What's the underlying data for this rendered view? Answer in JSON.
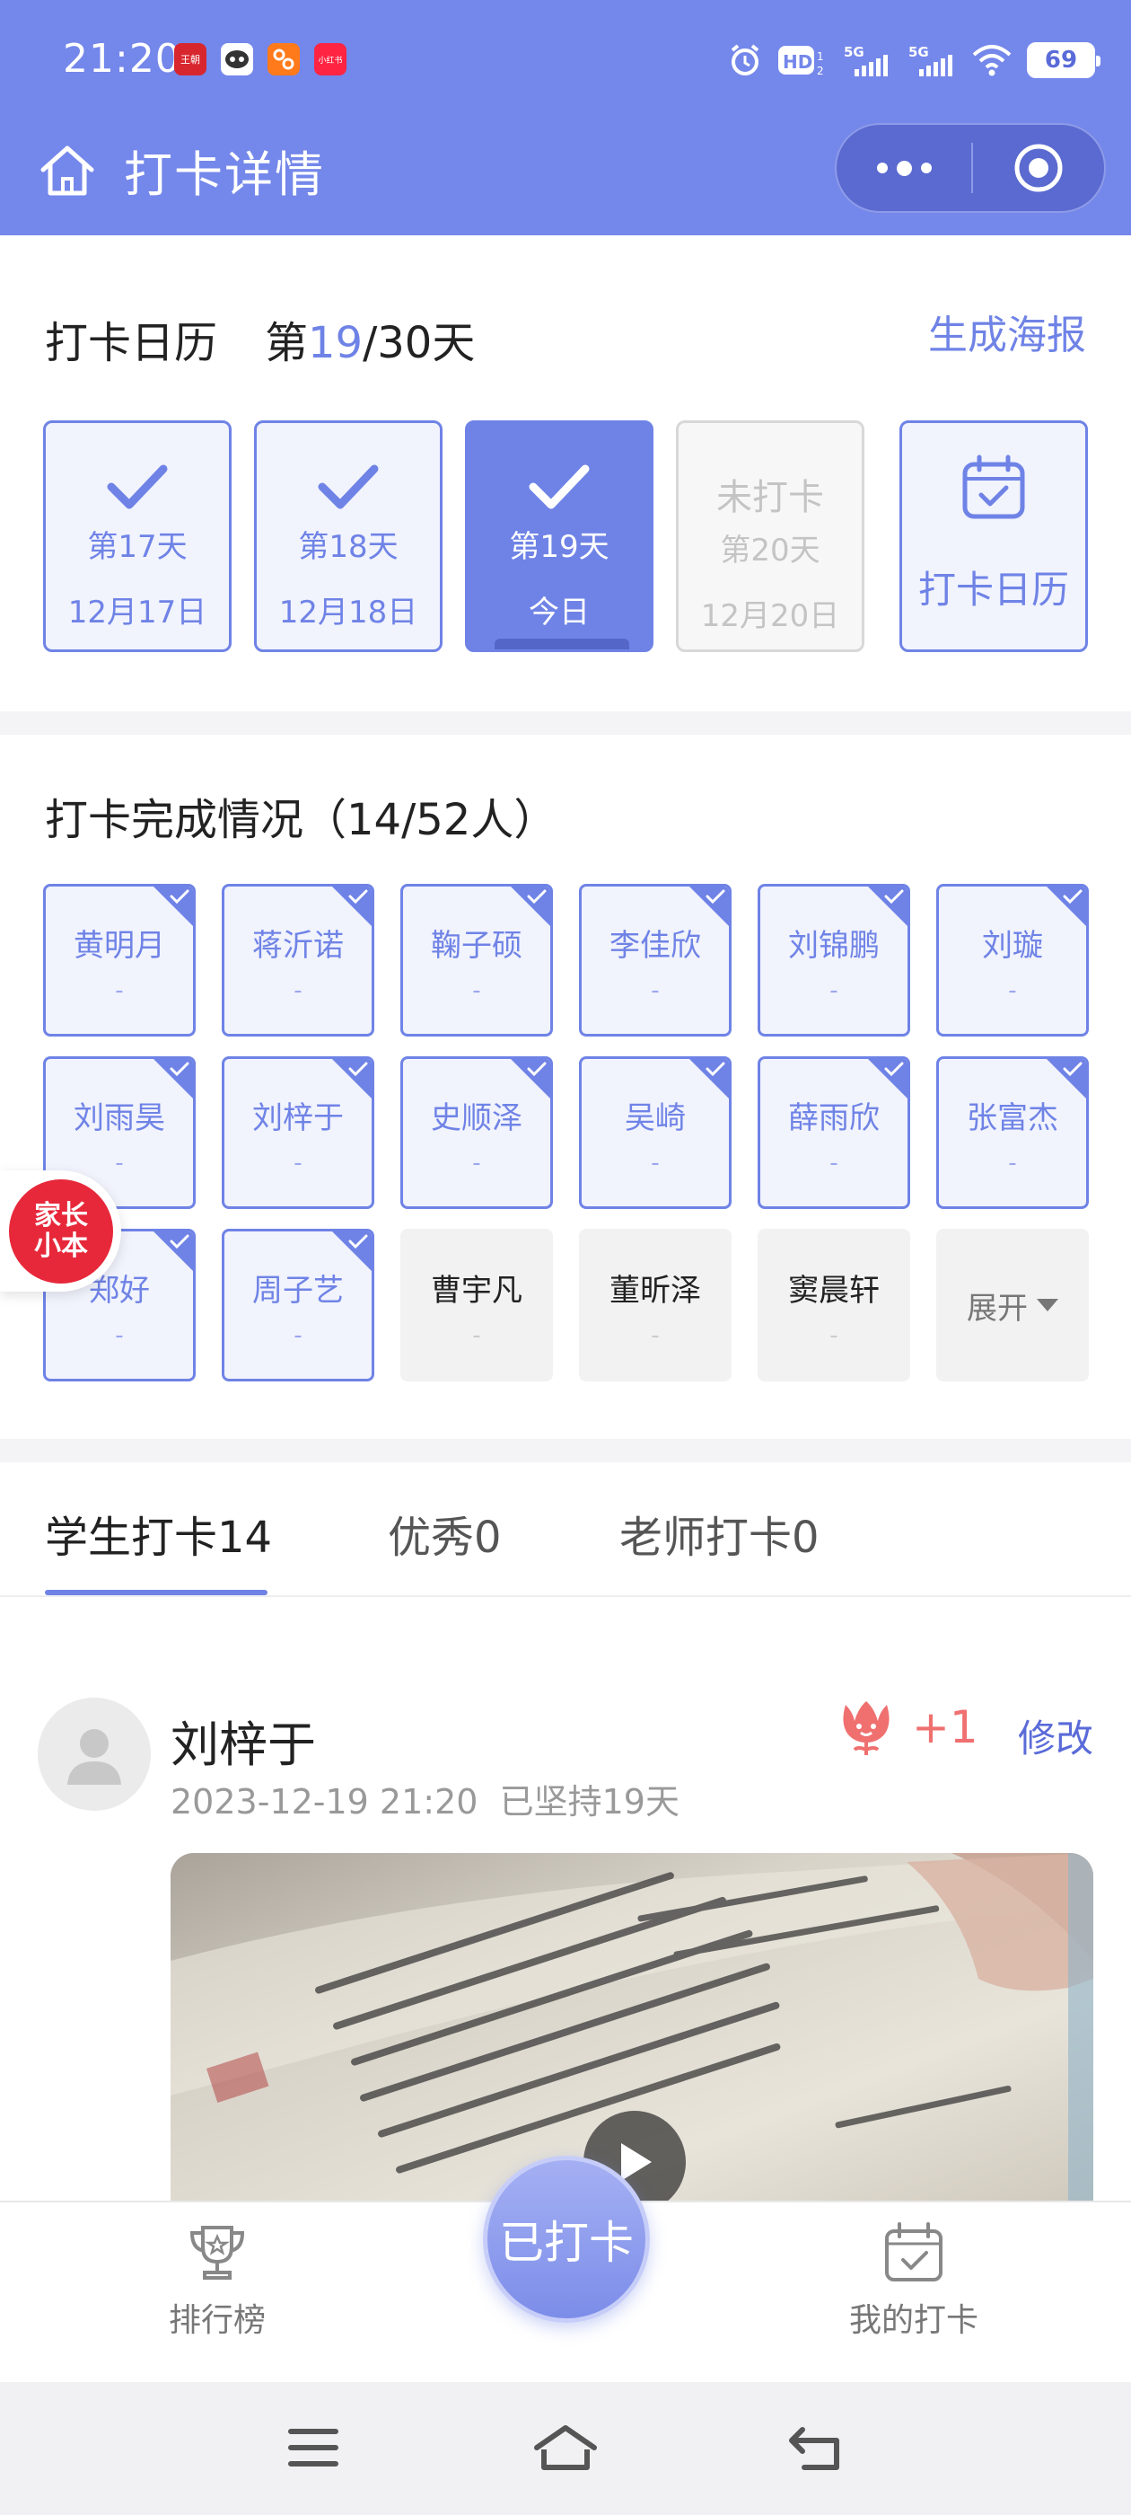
{
  "status_bar": {
    "time": "21:20",
    "app_icons": [
      {
        "name": "app-icon-1",
        "label": "王朝",
        "color": "#d8262e"
      },
      {
        "name": "app-icon-2",
        "label": "",
        "color": "#ffffff"
      },
      {
        "name": "app-icon-3",
        "label": "",
        "color": "#ff7a1a"
      },
      {
        "name": "app-icon-4",
        "label": "小红书",
        "color": "#ff2442"
      }
    ],
    "battery": "69"
  },
  "nav": {
    "title": "打卡详情"
  },
  "calendar": {
    "title": "打卡日历",
    "day_prefix": "第",
    "day_current": "19",
    "day_suffix": "/30天",
    "poster_label": "生成海报",
    "days": [
      {
        "day": "第17天",
        "date": "12月17日",
        "state": "done"
      },
      {
        "day": "第18天",
        "date": "12月18日",
        "state": "done"
      },
      {
        "day": "第19天",
        "date": "今日",
        "state": "today"
      },
      {
        "status": "未打卡",
        "day": "第20天",
        "date": "12月20日",
        "state": "future"
      }
    ],
    "calendar_button_label": "打卡日历"
  },
  "completion": {
    "title": "打卡完成情况（14/52人）",
    "students": [
      {
        "name": "黄明月",
        "sub": "-",
        "done": true
      },
      {
        "name": "蒋沂诺",
        "sub": "-",
        "done": true
      },
      {
        "name": "鞠子硕",
        "sub": "-",
        "done": true
      },
      {
        "name": "李佳欣",
        "sub": "-",
        "done": true
      },
      {
        "name": "刘锦鹏",
        "sub": "-",
        "done": true
      },
      {
        "name": "刘璇",
        "sub": "-",
        "done": true
      },
      {
        "name": "刘雨昊",
        "sub": "-",
        "done": true
      },
      {
        "name": "刘梓于",
        "sub": "-",
        "done": true
      },
      {
        "name": "史顺泽",
        "sub": "-",
        "done": true
      },
      {
        "name": "吴崎",
        "sub": "-",
        "done": true
      },
      {
        "name": "薛雨欣",
        "sub": "-",
        "done": true
      },
      {
        "name": "张富杰",
        "sub": "-",
        "done": true
      },
      {
        "name": "郑好",
        "sub": "-",
        "done": true
      },
      {
        "name": "周子艺",
        "sub": "-",
        "done": true
      },
      {
        "name": "曹宇凡",
        "sub": "-",
        "done": false
      },
      {
        "name": "董昕泽",
        "sub": "-",
        "done": false
      },
      {
        "name": "窦晨轩",
        "sub": "-",
        "done": false
      }
    ],
    "expand_label": "展开"
  },
  "float_badge": {
    "line1": "家长",
    "line2": "小本"
  },
  "tabs": [
    {
      "label": "学生打卡14",
      "active": true
    },
    {
      "label": "优秀0",
      "active": false
    },
    {
      "label": "老师打卡0",
      "active": false
    }
  ],
  "post": {
    "name": "刘梓于",
    "datetime": "2023-12-19 21:20",
    "streak": "已坚持19天",
    "likes": "+1",
    "edit_label": "修改"
  },
  "bottom_bar": {
    "ranking_label": "排行榜",
    "checkin_label": "已打卡",
    "mine_label": "我的打卡"
  },
  "theme": {
    "primary": "#6f83e6",
    "header": "#7487ea",
    "like": "#f07070"
  }
}
